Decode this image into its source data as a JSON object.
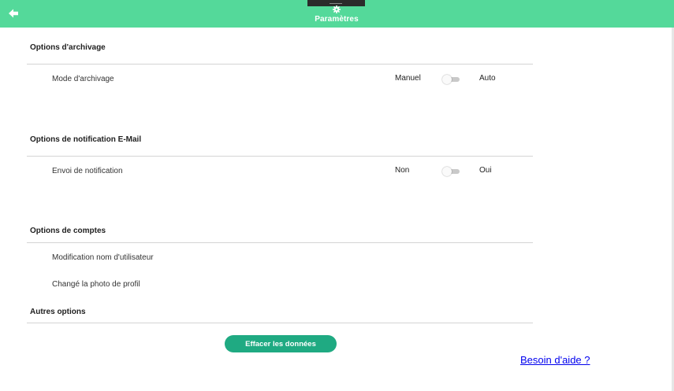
{
  "header": {
    "title": "Paramètres",
    "back_icon": "arrow-left-icon",
    "settings_icon": "gear-icon",
    "background": "#54d99a"
  },
  "sections": {
    "archive": {
      "title": "Options d'archivage",
      "row_label": "Mode d'archivage",
      "option_off": "Manuel",
      "option_on": "Auto",
      "toggle_on": false
    },
    "notification": {
      "title": "Options de notification E-Mail",
      "row_label": "Envoi de notification",
      "option_off": "Non",
      "option_on": "Oui",
      "toggle_on": false
    },
    "accounts": {
      "title": "Options de comptes",
      "items": [
        "Modification nom d'utilisateur",
        "Changé la photo de profil"
      ]
    },
    "other": {
      "title": "Autres options",
      "clear_button": "Effacer les données"
    }
  },
  "help_link": "Besoin d'aide ?",
  "colors": {
    "accent": "#54d99a",
    "button": "#1faa82",
    "link": "#0000ee"
  }
}
